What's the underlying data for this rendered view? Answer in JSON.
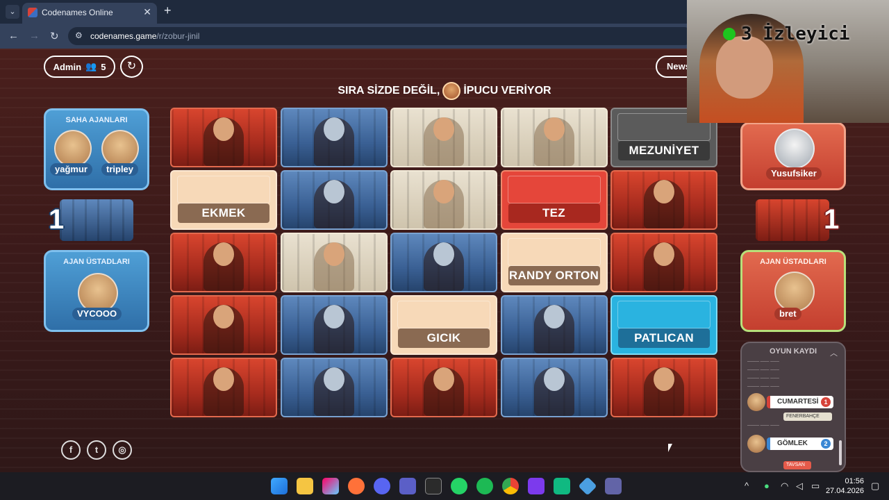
{
  "browser": {
    "tab_title": "Codenames Online",
    "url_host": "codenames.game",
    "url_path": "/r/zobur-jinil",
    "new_tab_glyph": "+",
    "close_glyph": "✕",
    "dropdown_glyph": "⌄"
  },
  "header": {
    "admin_label": "Admin",
    "player_count": "5",
    "news_label": "News",
    "turn_text_left": "SIRA SİZDE DEĞİL,",
    "turn_text_right": "İPUCU VERİYOR"
  },
  "blue_team": {
    "operatives_title": "SAHA AJANLARI",
    "operatives": [
      "yağmur",
      "tripley"
    ],
    "score": "1",
    "spymasters_title": "AJAN ÜSTADLARI",
    "spymaster": "VYCOOO"
  },
  "red_team": {
    "operative": "Yusufsiker",
    "score": "1",
    "spymasters_title": "AJAN ÜSTADLARI",
    "spymaster": "bret"
  },
  "board": {
    "cards": [
      {
        "kind": "red-agent",
        "label": ""
      },
      {
        "kind": "blue-agent",
        "label": ""
      },
      {
        "kind": "neutral-agent",
        "label": ""
      },
      {
        "kind": "neutral-agent",
        "label": ""
      },
      {
        "kind": "word-gray",
        "label": "MEZUNİYET"
      },
      {
        "kind": "word-neutral",
        "label": "EKMEK"
      },
      {
        "kind": "blue-agent",
        "label": ""
      },
      {
        "kind": "neutral-agent",
        "label": ""
      },
      {
        "kind": "word-red",
        "label": "TEZ"
      },
      {
        "kind": "red-agent",
        "label": ""
      },
      {
        "kind": "red-agent",
        "label": ""
      },
      {
        "kind": "neutral-agent",
        "label": ""
      },
      {
        "kind": "blue-agent",
        "label": ""
      },
      {
        "kind": "word-neutral",
        "label": "RANDY ORTON"
      },
      {
        "kind": "red-agent",
        "label": ""
      },
      {
        "kind": "red-agent",
        "label": ""
      },
      {
        "kind": "blue-agent",
        "label": ""
      },
      {
        "kind": "word-neutral",
        "label": "GICIK"
      },
      {
        "kind": "blue-agent",
        "label": ""
      },
      {
        "kind": "word-cyan",
        "label": "PATLICAN"
      },
      {
        "kind": "red-agent",
        "label": ""
      },
      {
        "kind": "blue-agent",
        "label": ""
      },
      {
        "kind": "red-agent",
        "label": ""
      },
      {
        "kind": "blue-agent",
        "label": ""
      },
      {
        "kind": "red-agent",
        "label": ""
      }
    ]
  },
  "log": {
    "title": "OYUN KAYDI",
    "clues": [
      {
        "word": "CUMARTESİ",
        "number": "1",
        "team": "red",
        "player": "bret"
      },
      {
        "word": "GÖMLEK",
        "number": "2",
        "team": "blue",
        "player": "VYCOOO"
      }
    ],
    "guess_tags": [
      "FENERBAHÇE",
      "TAVSAN"
    ]
  },
  "webcam": {
    "viewers_text": "3 İzleyici"
  },
  "taskbar": {
    "time": "01:56",
    "date": "27.04.2026"
  },
  "colors": {
    "red_team": "#d6433a",
    "blue_team": "#3a87d4",
    "neutral": "#f7d9b8",
    "assassin": "#5b5b5b",
    "cyan": "#2ab3e0"
  }
}
